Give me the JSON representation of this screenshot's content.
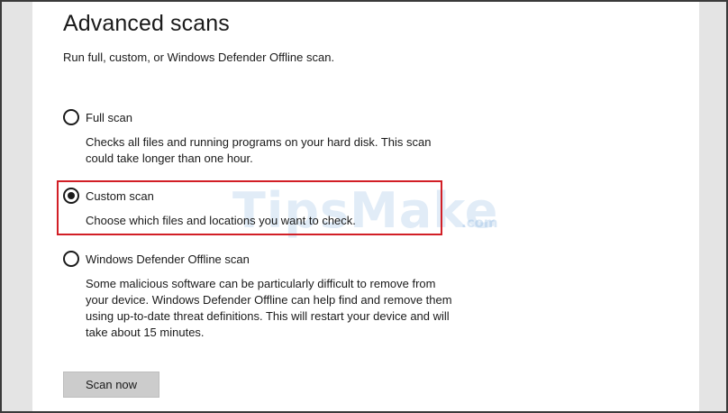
{
  "page": {
    "title": "Advanced scans",
    "subtitle": "Run full, custom, or Windows Defender Offline scan."
  },
  "options": [
    {
      "label": "Full scan",
      "description": "Checks all files and running programs on your hard disk. This scan could take longer than one hour.",
      "selected": false
    },
    {
      "label": "Custom scan",
      "description": "Choose which files and locations you want to check.",
      "selected": true
    },
    {
      "label": "Windows Defender Offline scan",
      "description": "Some malicious software can be particularly difficult to remove from your device. Windows Defender Offline can help find and remove them using up-to-date threat definitions. This will restart your device and will take about 15 minutes.",
      "selected": false
    }
  ],
  "actions": {
    "scan_now_label": "Scan now"
  },
  "watermark": {
    "text": "TipsMake",
    "suffix": ".com"
  },
  "colors": {
    "highlight": "#d21f26",
    "button_bg": "#cccccc",
    "side_strip": "#e4e4e4"
  }
}
